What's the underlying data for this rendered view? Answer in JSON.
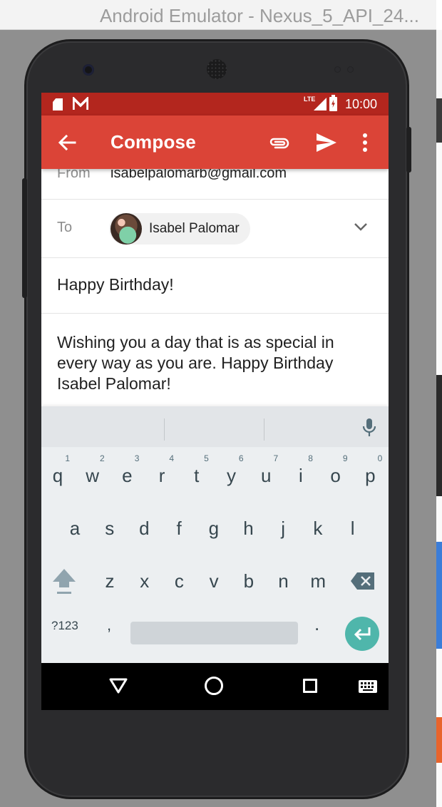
{
  "window": {
    "title": "Android Emulator - Nexus_5_API_24..."
  },
  "status_bar": {
    "network_label": "LTE",
    "time": "10:00"
  },
  "app_bar": {
    "title": "Compose"
  },
  "from": {
    "label": "From",
    "value": "isabelpalomarb@gmail.com"
  },
  "to": {
    "label": "To",
    "recipient": "Isabel Palomar"
  },
  "subject": "Happy Birthday!",
  "body": "Wishing you a day that is as special in every way as you are. Happy Birthday Isabel Palomar!",
  "keyboard": {
    "row1": [
      {
        "key": "q",
        "hint": "1"
      },
      {
        "key": "w",
        "hint": "2"
      },
      {
        "key": "e",
        "hint": "3"
      },
      {
        "key": "r",
        "hint": "4"
      },
      {
        "key": "t",
        "hint": "5"
      },
      {
        "key": "y",
        "hint": "6"
      },
      {
        "key": "u",
        "hint": "7"
      },
      {
        "key": "i",
        "hint": "8"
      },
      {
        "key": "o",
        "hint": "9"
      },
      {
        "key": "p",
        "hint": "0"
      }
    ],
    "row2": [
      "a",
      "s",
      "d",
      "f",
      "g",
      "h",
      "j",
      "k",
      "l"
    ],
    "row3": [
      "z",
      "x",
      "c",
      "v",
      "b",
      "n",
      "m"
    ],
    "symbols_label": "?123",
    "comma_label": ",",
    "period_label": "."
  },
  "colors": {
    "status_bar": "#b3261e",
    "app_bar": "#db4437",
    "enter_key": "#4fb6ab",
    "keyboard_bg": "#eceff1"
  },
  "icons": [
    "back-arrow-icon",
    "attach-icon",
    "send-icon",
    "more-vert-icon",
    "chevron-down-icon",
    "mic-icon",
    "shift-icon",
    "backspace-icon",
    "enter-icon",
    "nav-back-icon",
    "nav-home-icon",
    "nav-recents-icon",
    "keyboard-icon"
  ]
}
